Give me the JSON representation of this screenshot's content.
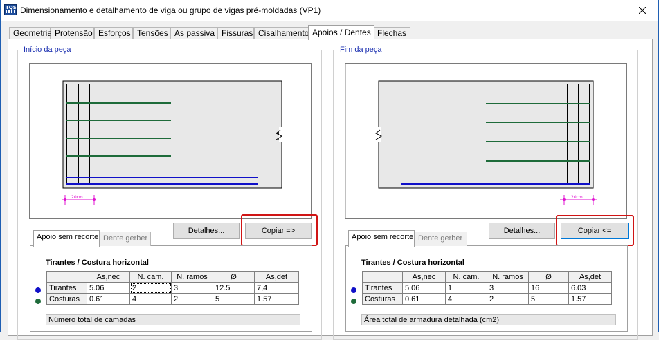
{
  "window": {
    "title": "Dimensionamento e detalhamento de viga ou grupo de vigas pré-moldadas (VP1)",
    "icon_text": "TQS"
  },
  "tabs": [
    {
      "label": "Geometria"
    },
    {
      "label": "Protensão"
    },
    {
      "label": "Esforços"
    },
    {
      "label": "Tensões"
    },
    {
      "label": "As passiva"
    },
    {
      "label": "Fissuras"
    },
    {
      "label": "Cisalhamento"
    },
    {
      "label": "Apoios / Dentes",
      "active": true
    },
    {
      "label": "Flechas"
    }
  ],
  "left": {
    "legend": "Início da peça",
    "dimension_label": "20cm",
    "details_button": "Detalhes...",
    "copy_button": "Copiar =>",
    "subtabs": [
      "Apoio sem recorte",
      "Dente gerber"
    ],
    "table_title": "Tirantes / Costura horizontal",
    "columns": [
      "",
      "As,nec",
      "N. cam.",
      "N. ramos",
      "Ø",
      "As,det"
    ],
    "rows": [
      {
        "name": "Tirantes",
        "cells": [
          "5.06",
          "2",
          "3",
          "12.5",
          "7,4"
        ]
      },
      {
        "name": "Costuras",
        "cells": [
          "0.61",
          "4",
          "2",
          "5",
          "1.57"
        ]
      }
    ],
    "status": "Número total de camadas"
  },
  "right": {
    "legend": "Fim da peça",
    "dimension_label": "20cm",
    "details_button": "Detalhes...",
    "copy_button": "Copiar <=",
    "subtabs": [
      "Apoio sem recorte",
      "Dente gerber"
    ],
    "table_title": "Tirantes / Costura horizontal",
    "columns": [
      "",
      "As,nec",
      "N. cam.",
      "N. ramos",
      "Ø",
      "As,det"
    ],
    "rows": [
      {
        "name": "Tirantes",
        "cells": [
          "5.06",
          "1",
          "3",
          "16",
          "6.03"
        ]
      },
      {
        "name": "Costuras",
        "cells": [
          "0.61",
          "4",
          "2",
          "5",
          "1.57"
        ]
      }
    ],
    "status": "Área total de armadura detalhada (cm2)"
  },
  "colors": {
    "tirante_dot": "#1010c8",
    "costura_dot": "#1e6b3a",
    "longitudinal_bar": "#1010c8",
    "horizontal_stirrup": "#1e6b3a",
    "dimension": "#e010d0",
    "highlight": "#d01515",
    "legend_text": "#1a2fb0"
  }
}
